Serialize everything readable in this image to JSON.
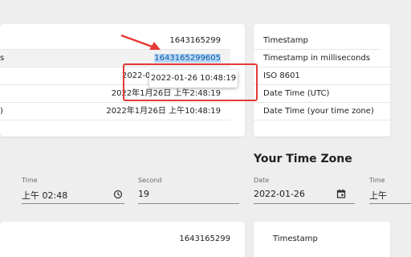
{
  "tooltip": {
    "text": "2022-01-26 10:48:19"
  },
  "left_table": {
    "rows": [
      {
        "cut_label": "",
        "value": "1643165299"
      },
      {
        "cut_label": "s",
        "value": "1643165299605"
      },
      {
        "cut_label": "",
        "value": "2022-01"
      },
      {
        "cut_label": "",
        "value": "2022年1月26日 上午2:48:19"
      },
      {
        "cut_label": ")",
        "value": "2022年1月26日 上午10:48:19"
      }
    ]
  },
  "right_table": {
    "rows": [
      {
        "label": "Timestamp"
      },
      {
        "label": "Timestamp in milliseconds"
      },
      {
        "label": "ISO 8601"
      },
      {
        "label": "Date Time (UTC)"
      },
      {
        "label": "Date Time (your time zone)"
      }
    ]
  },
  "your_time_zone": {
    "title": "Your Time Zone",
    "time_label": "Time",
    "time_value": "上午 02:48",
    "second_label": "Second",
    "second_value": "19",
    "date_label": "Date",
    "date_value": "2022-01-26",
    "time2_label": "Time",
    "time2_value": "上午"
  },
  "bottom": {
    "left_value": "1643165299",
    "right_label": "Timestamp"
  },
  "colors": {
    "highlight": "#b8d7f5",
    "annotation_red": "#e53935"
  }
}
